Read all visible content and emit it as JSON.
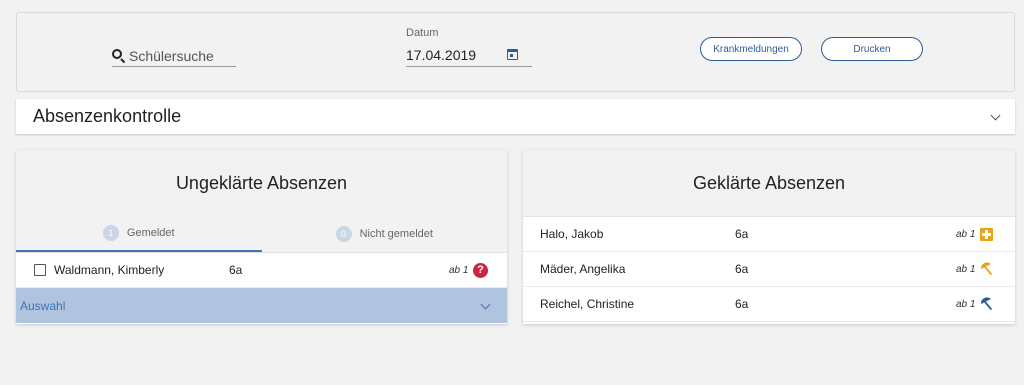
{
  "filter": {
    "search_placeholder": "Schülersuche",
    "date_label": "Datum",
    "date_value": "17.04.2019",
    "krankmeldungen_label": "Krankmeldungen",
    "drucken_label": "Drucken"
  },
  "section": {
    "title": "Absenzenkontrolle"
  },
  "ungeklaert": {
    "title": "Ungeklärte Absenzen",
    "tabs": [
      {
        "count": "1",
        "label": "Gemeldet",
        "active": true
      },
      {
        "count": "0",
        "label": "Nicht gemeldet",
        "active": false
      }
    ],
    "rows": [
      {
        "name": "Waldmann, Kimberly",
        "klasse": "6a",
        "ab": "ab 1",
        "status_icon": "question-icon"
      }
    ],
    "auswahl_label": "Auswahl"
  },
  "geklaert": {
    "title": "Geklärte Absenzen",
    "rows": [
      {
        "name": "Halo, Jakob",
        "klasse": "6a",
        "ab": "ab 1",
        "status_icon": "plus-icon",
        "color": "#e8a51c"
      },
      {
        "name": "Mäder, Angelika",
        "klasse": "6a",
        "ab": "ab 1",
        "status_icon": "umbrella-icon",
        "color": "#e8a51c"
      },
      {
        "name": "Reichel, Christine",
        "klasse": "6a",
        "ab": "ab 1",
        "status_icon": "umbrella-icon",
        "color": "#2d5d94"
      }
    ]
  },
  "colors": {
    "accent": "#2d5d94",
    "tab_active": "#3d73b4",
    "alert": "#d0233c",
    "selection_bar": "#b0c4df"
  }
}
